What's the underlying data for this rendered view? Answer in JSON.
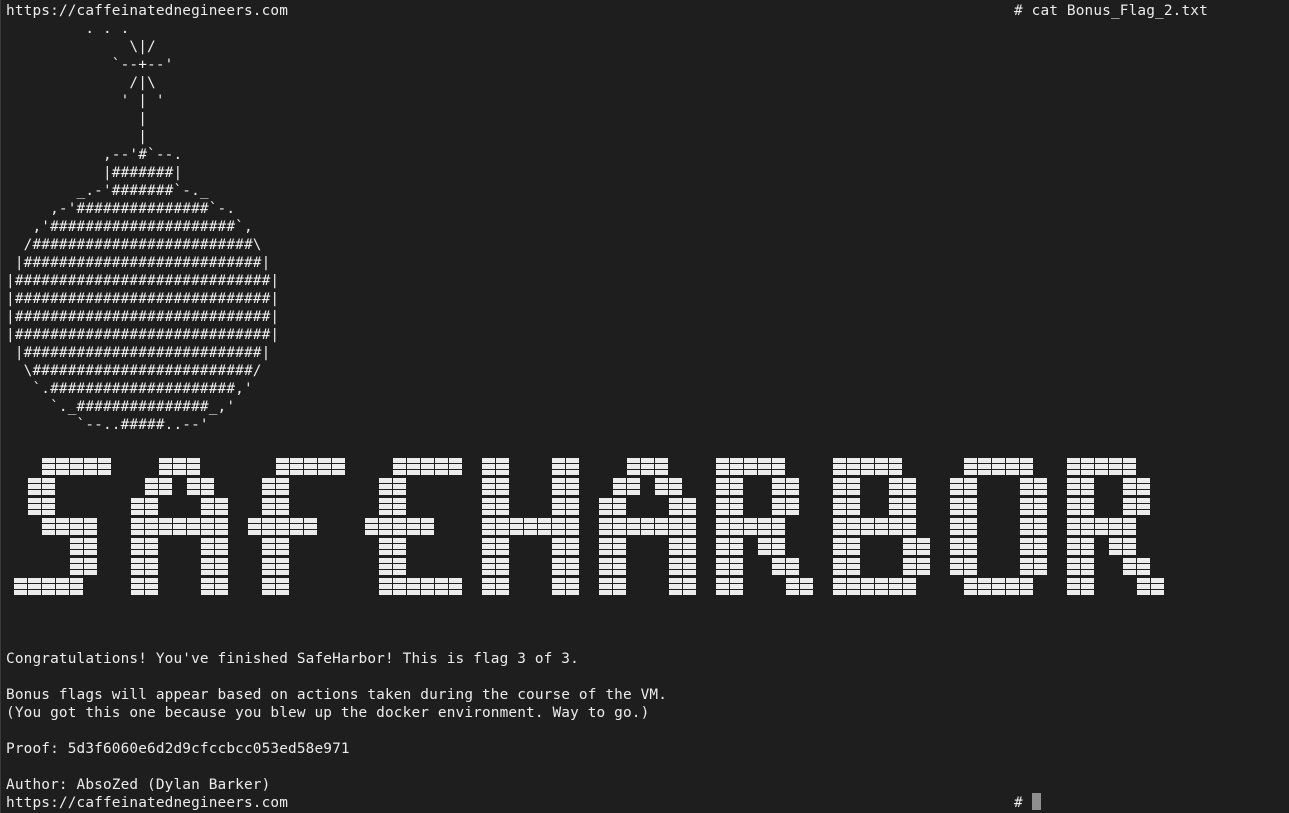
{
  "terminal": {
    "top_prompt_left": "https://caffeinatednegineers.com",
    "top_prompt_right": "# cat Bonus_Flag_2.txt",
    "bomb_art": [
      "         . . .",
      "              \\|/",
      "            `--+--'",
      "              /|\\",
      "             ' | '",
      "               |",
      "               |",
      "           ,--'#`--.",
      "           |#######|",
      "        _.-'#######`-._",
      "     ,-'###############`-.",
      "   ,'#####################`,",
      "  /#########################\\",
      " |###########################|",
      "|#############################|",
      "|#############################|",
      "|#############################|",
      "|#############################|",
      " |###########################|",
      "  \\#########################/",
      "   `.#####################,'",
      "     `._###############_,'",
      "        `--..#####..--'"
    ],
    "banner_text": "SAFEHARBOR",
    "messages": {
      "congrats": "Congratulations! You've finished SafeHarbor! This is flag 3 of 3.",
      "bonus_line1": "Bonus flags will appear based on actions taken during the course of the VM.",
      "bonus_line2": "(You got this one because you blew up the docker environment. Way to go.)",
      "proof": "Proof: 5d3f6060e6d2d9cfccbcc053ed58e971",
      "author": "Author: AbsoZed (Dylan Barker)"
    },
    "bottom_prompt_left": "https://caffeinatednegineers.com",
    "bottom_prompt_right": "#"
  },
  "colors": {
    "background": "#1e1e1e",
    "foreground": "#ececec",
    "cursor": "#8f8f8f"
  }
}
